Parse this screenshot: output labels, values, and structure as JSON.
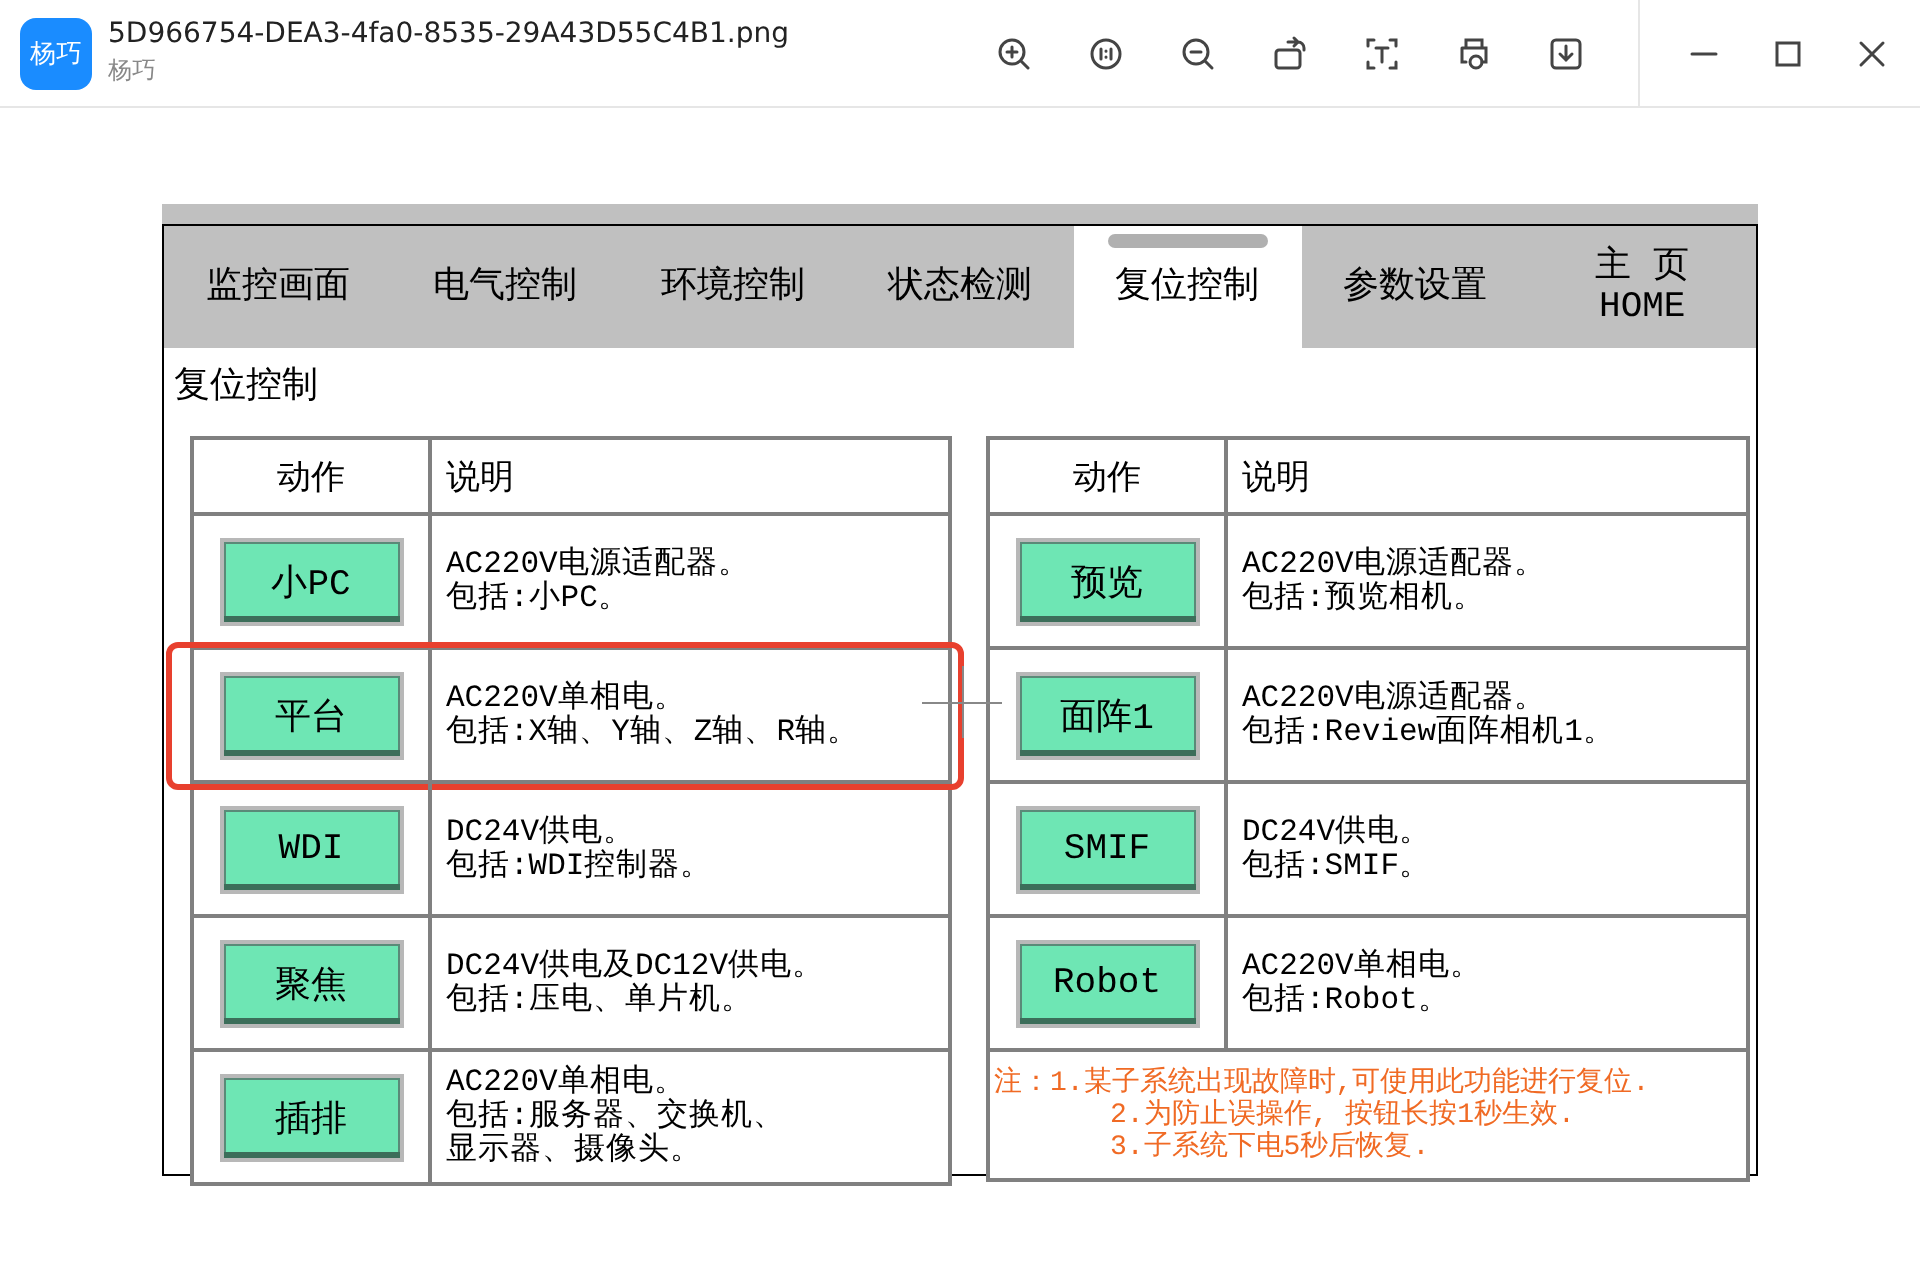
{
  "viewer": {
    "app_badge": "杨巧",
    "file_name": "5D966754-DEA3-4fa0-8535-29A43D55C4B1.png",
    "app_name": "杨巧"
  },
  "hmi": {
    "tabs": [
      {
        "label": "监控画面",
        "selected": false
      },
      {
        "label": "电气控制",
        "selected": false
      },
      {
        "label": "环境控制",
        "selected": false
      },
      {
        "label": "状态检测",
        "selected": false
      },
      {
        "label": "复位控制",
        "selected": true
      },
      {
        "label": "参数设置",
        "selected": false
      },
      {
        "label": "主 页\nHOME",
        "selected": false
      }
    ],
    "section_title": "复位控制",
    "left_table": {
      "columns": [
        "动作",
        "说明"
      ],
      "rows": [
        {
          "action": "小PC",
          "description": [
            "AC220V电源适配器。",
            "包括:小PC。"
          ],
          "highlighted": false
        },
        {
          "action": "平台",
          "description": [
            "AC220V单相电。",
            "包括:X轴、Y轴、Z轴、R轴。"
          ],
          "highlighted": true
        },
        {
          "action": "WDI",
          "description": [
            "DC24V供电。",
            "包括:WDI控制器。"
          ],
          "highlighted": false
        },
        {
          "action": "聚焦",
          "description": [
            "DC24V供电及DC12V供电。",
            "包括:压电、单片机。"
          ],
          "highlighted": false
        },
        {
          "action": "插排",
          "description": [
            "AC220V单相电。",
            "包括:服务器、交换机、",
            "显示器、摄像头。"
          ],
          "highlighted": false
        }
      ]
    },
    "right_table": {
      "columns": [
        "动作",
        "说明"
      ],
      "rows": [
        {
          "action": "预览",
          "description": [
            "AC220V电源适配器。",
            "包括:预览相机。"
          ],
          "highlighted": false
        },
        {
          "action": "面阵1",
          "description": [
            "AC220V电源适配器。",
            "包括:Review面阵相机1。"
          ],
          "highlighted": false
        },
        {
          "action": "SMIF",
          "description": [
            "DC24V供电。",
            "包括:SMIF。"
          ],
          "highlighted": false
        },
        {
          "action": "Robot",
          "description": [
            "AC220V单相电。",
            "包括:Robot。"
          ],
          "highlighted": false
        }
      ],
      "note": {
        "label": "注：",
        "items": [
          "1.某子系统出现故障时,可使用此功能进行复位.",
          "2.为防止误操作, 按钮长按1秒生效.",
          "3.子系统下电5秒后恢复."
        ]
      }
    }
  }
}
